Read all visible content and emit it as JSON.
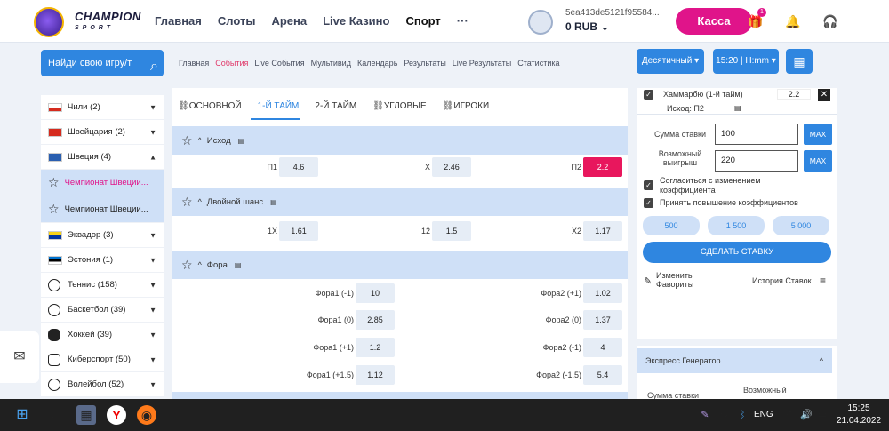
{
  "header": {
    "brand": "CHAMPION",
    "brand_sub": "SPORT",
    "nav": [
      "Главная",
      "Слоты",
      "Арена",
      "Live Казино",
      "Спорт",
      "···"
    ],
    "account_id": "5ea413de5121f95584...",
    "balance": "0 RUB",
    "kassa": "Касса",
    "gift_badge": "1"
  },
  "search": {
    "label": "Найди свою игру/т"
  },
  "subnav": [
    "Главная",
    "События",
    "Live События",
    "Мультивид",
    "Календарь",
    "Результаты",
    "Live Результаты",
    "Статистика"
  ],
  "odds_format": "Десятичный",
  "time_format": "15:20 | H:mm",
  "sidebar": {
    "items": [
      {
        "label": "Чили (2)"
      },
      {
        "label": "Швейцария (2)"
      },
      {
        "label": "Швеция (4)"
      },
      {
        "label": "Чемпионат Швеции..."
      },
      {
        "label": "Чемпионат Швеции..."
      },
      {
        "label": "Эквадор (3)"
      },
      {
        "label": "Эстония (1)"
      },
      {
        "label": "Теннис (158)"
      },
      {
        "label": "Баскетбол (39)"
      },
      {
        "label": "Хоккей (39)"
      },
      {
        "label": "Киберспорт (50)"
      },
      {
        "label": "Волейбол (52)"
      }
    ]
  },
  "market_tabs": [
    "ОСНОВНОЙ",
    "1-Й ТАЙМ",
    "2-Й ТАЙМ",
    "УГЛОВЫЕ",
    "ИГРОКИ"
  ],
  "markets": {
    "ishod": {
      "title": "Исход",
      "p1": "П1",
      "p1v": "4.6",
      "x": "X",
      "xv": "2.46",
      "p2": "П2",
      "p2v": "2.2"
    },
    "double": {
      "title": "Двойной шанс",
      "a": "1X",
      "av": "1.61",
      "b": "12",
      "bv": "1.5",
      "c": "X2",
      "cv": "1.17"
    },
    "fora": {
      "title": "Фора",
      "rows": [
        {
          "l": "Фора1 (-1)",
          "lv": "10",
          "r": "Фора2 (+1)",
          "rv": "1.02"
        },
        {
          "l": "Фора1 (0)",
          "lv": "2.85",
          "r": "Фора2 (0)",
          "rv": "1.37"
        },
        {
          "l": "Фора1 (+1)",
          "lv": "1.2",
          "r": "Фора2 (-1)",
          "rv": "4"
        },
        {
          "l": "Фора1 (+1.5)",
          "lv": "1.12",
          "r": "Фора2 (-1.5)",
          "rv": "5.4"
        }
      ]
    }
  },
  "betslip": {
    "match": "Хаммарбю (1-й тайм)",
    "odd": "2.2",
    "outcome": "Исход: П2",
    "stake_label": "Сумма ставки",
    "stake": "100",
    "max": "MAX",
    "win_label": "Возможный выигрыш",
    "win": "220",
    "agree_change": "Согласиться с изменением коэффициента",
    "accept_up": "Принять повышение коэффициентов",
    "quick": [
      "500",
      "1 500",
      "5 000"
    ],
    "place": "СДЕЛАТЬ СТАВКУ",
    "edit_fav": "Изменить Фавориты",
    "history": "История Ставок"
  },
  "express": {
    "title": "Экспресс Генератор",
    "stake": "Сумма ставки",
    "win": "Возможный"
  },
  "taskbar": {
    "lang": "ENG",
    "time": "15:25",
    "date": "21.04.2022"
  }
}
